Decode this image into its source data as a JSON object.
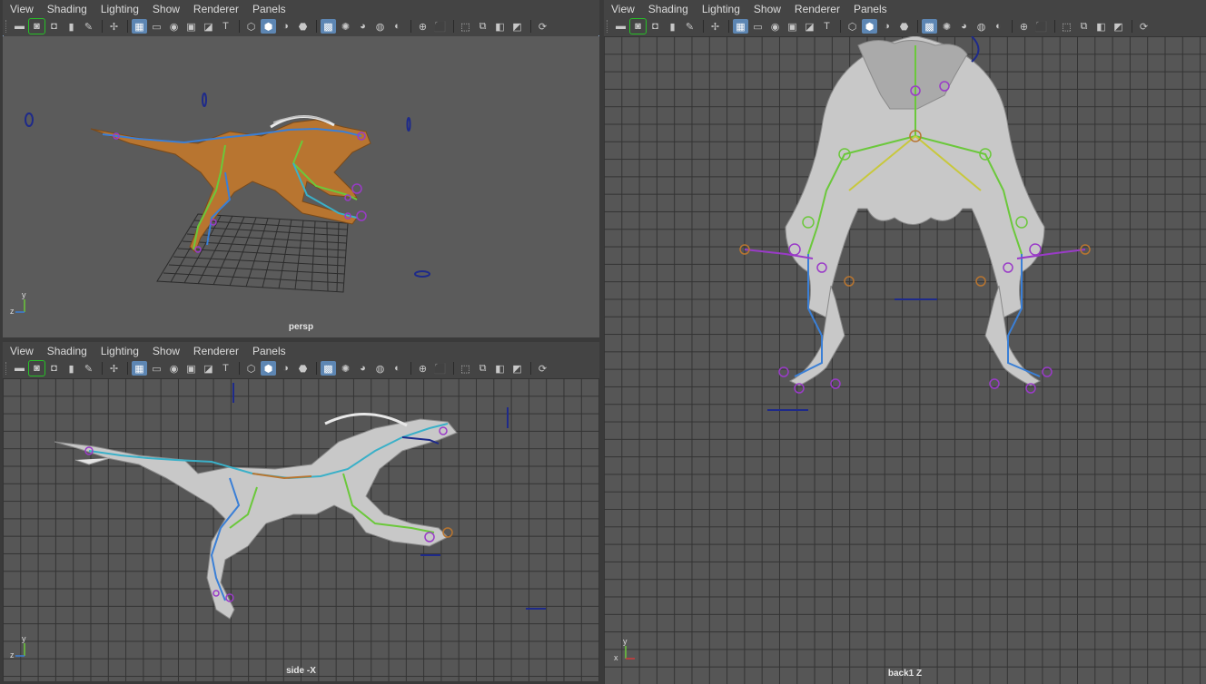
{
  "menus": [
    "View",
    "Shading",
    "Lighting",
    "Show",
    "Renderer",
    "Panels"
  ],
  "toolbar_icons": [
    {
      "name": "select-camera-icon",
      "glyph": "▬"
    },
    {
      "name": "camera-attributes-icon",
      "glyph": "◙"
    },
    {
      "name": "bookmarks-icon",
      "glyph": "◘"
    },
    {
      "name": "image-plane-icon",
      "glyph": "▮"
    },
    {
      "name": "2d-pan-zoom-icon",
      "glyph": "✎"
    },
    {
      "name": "grease-pencil-icon",
      "glyph": "✢"
    },
    {
      "name": "grid-icon",
      "glyph": "▦",
      "active": true
    },
    {
      "name": "film-gate-icon",
      "glyph": "▭"
    },
    {
      "name": "resolution-gate-icon",
      "glyph": "◉"
    },
    {
      "name": "gate-mask-icon",
      "glyph": "▣"
    },
    {
      "name": "field-chart-icon",
      "glyph": "◪"
    },
    {
      "name": "safe-title-icon",
      "glyph": "T"
    },
    {
      "name": "wireframe-icon",
      "glyph": "⬡"
    },
    {
      "name": "smooth-shade-icon",
      "glyph": "⬢",
      "active": true
    },
    {
      "name": "default-material-icon",
      "glyph": "◑"
    },
    {
      "name": "wireframe-on-shaded-icon",
      "glyph": "⬣"
    },
    {
      "name": "xray-icon",
      "glyph": "▩",
      "active": true
    },
    {
      "name": "use-all-lights-icon",
      "glyph": "✺"
    },
    {
      "name": "shadows-icon",
      "glyph": "◕"
    },
    {
      "name": "screen-space-ao-icon",
      "glyph": "◍"
    },
    {
      "name": "motion-blur-icon",
      "glyph": "◐"
    },
    {
      "name": "anti-aliasing-icon",
      "glyph": "⊕"
    },
    {
      "name": "isolate-select-icon",
      "glyph": "⬛"
    },
    {
      "name": "xray-joints-icon",
      "glyph": "⬚"
    },
    {
      "name": "hud-icon",
      "glyph": "⧉"
    },
    {
      "name": "component-xray-icon",
      "glyph": "◧"
    },
    {
      "name": "frame-all-icon",
      "glyph": "◩"
    },
    {
      "name": "refresh-icon",
      "glyph": "⟳"
    }
  ],
  "panels": {
    "persp": {
      "camera": "persp"
    },
    "side": {
      "camera": "side -X"
    },
    "back": {
      "camera": "back1 Z"
    }
  },
  "axis_labels": {
    "y": "y",
    "z": "z",
    "x": "x"
  },
  "colors": {
    "active_border": "#8fb0d8",
    "grid_line": "#333333",
    "mesh_orange": "#b87530",
    "mesh_gray": "#c8c8c8",
    "joint_green": "#6bc83b",
    "joint_blue": "#3a7fd6",
    "joint_purple": "#9a3bc8"
  }
}
